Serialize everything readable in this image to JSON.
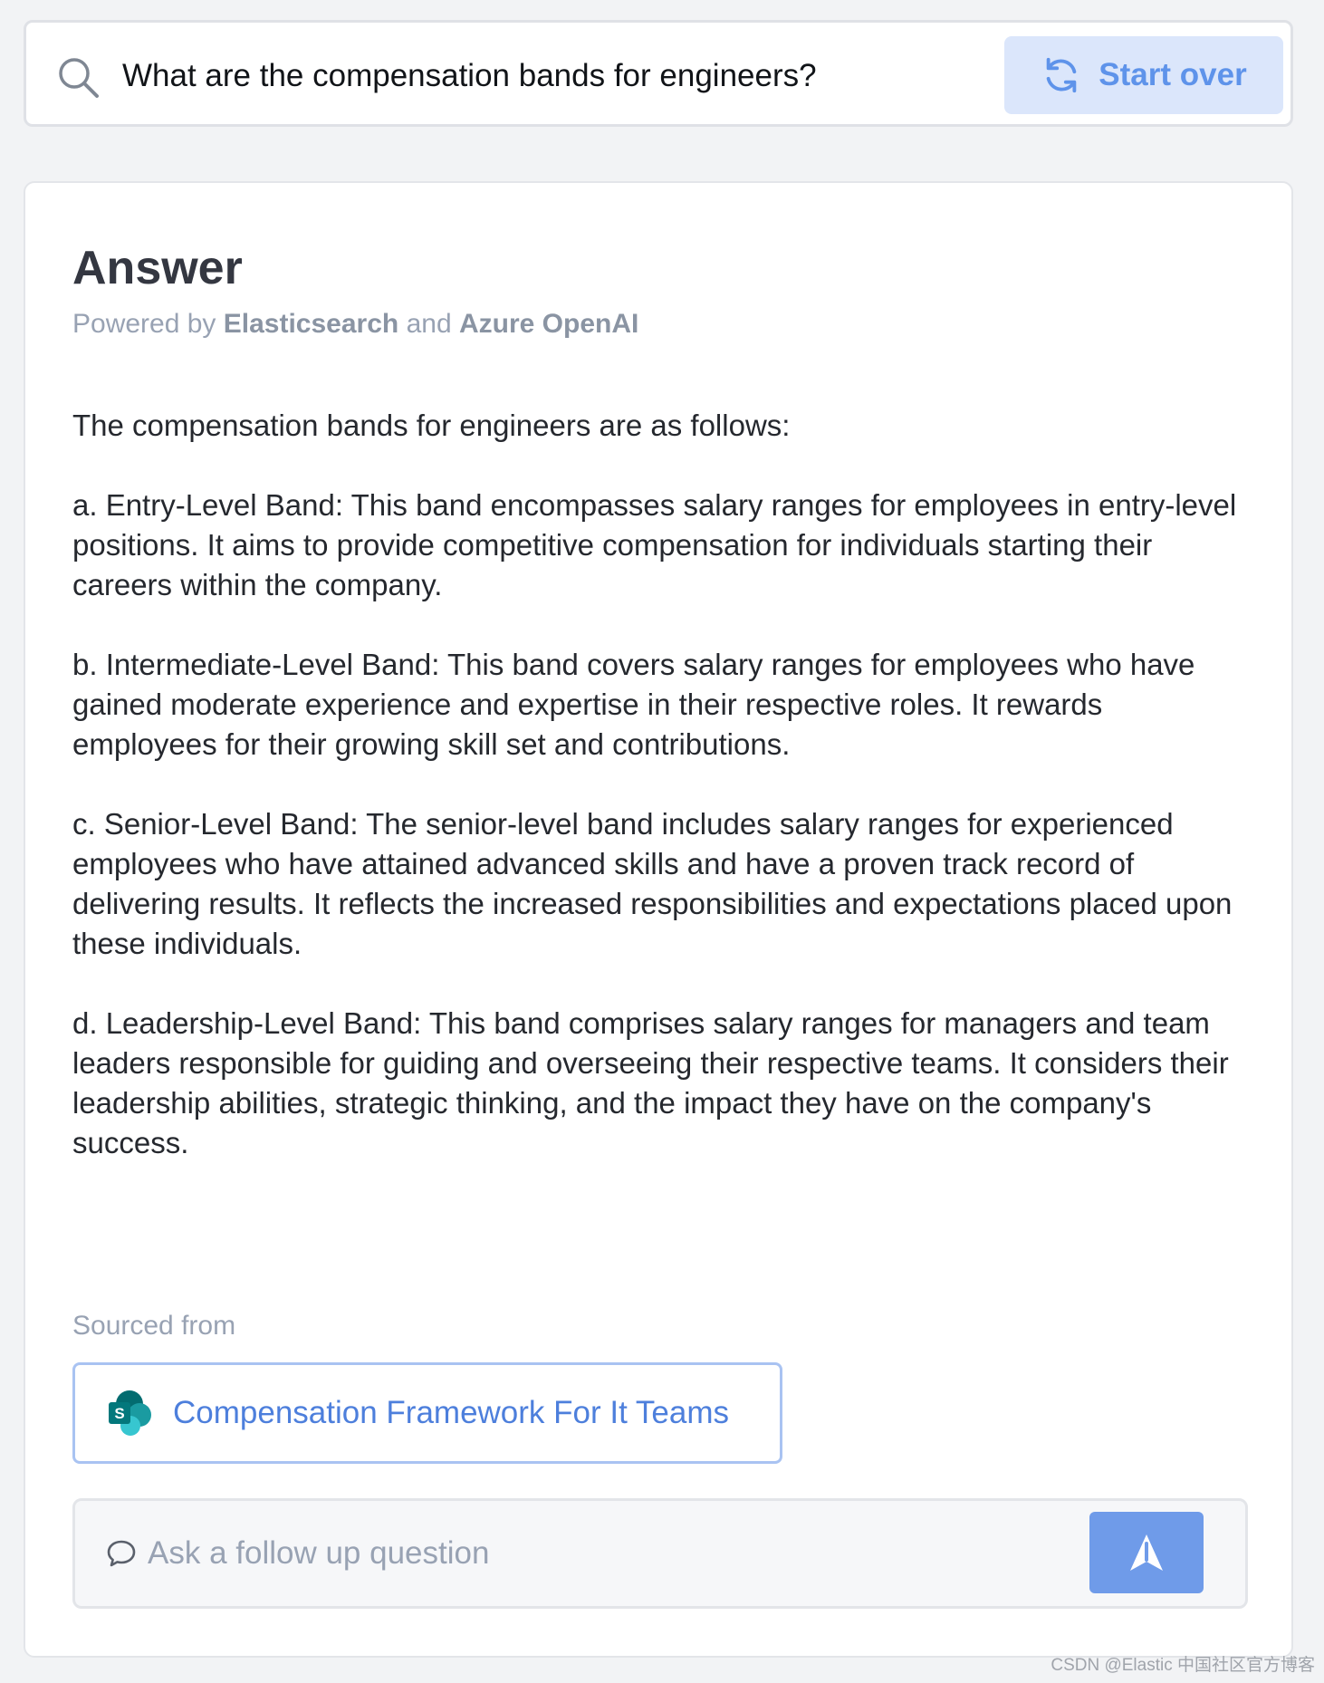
{
  "search": {
    "query": "What are the compensation bands for engineers?",
    "search_icon": "search-icon",
    "start_over_label": "Start over",
    "start_over_icon": "refresh-icon"
  },
  "answer": {
    "title": "Answer",
    "powered_by": {
      "prefix": "Powered by ",
      "engine": "Elasticsearch",
      "connector": " and ",
      "llm": "Azure OpenAI"
    },
    "paragraphs": [
      "The compensation bands for engineers are as follows:",
      "a. Entry-Level Band: This band encompasses salary ranges for employees in entry-level positions. It aims to provide competitive compensation for individuals starting their careers within the company.",
      "b. Intermediate-Level Band: This band covers salary ranges for employees who have gained moderate experience and expertise in their respective roles. It rewards employees for their growing skill set and contributions.",
      "c. Senior-Level Band: The senior-level band includes salary ranges for experienced employees who have attained advanced skills and have a proven track record of delivering results. It reflects the increased responsibilities and expectations placed upon these individuals.",
      "d. Leadership-Level Band: This band comprises salary ranges for managers and team leaders responsible for guiding and overseeing their respective teams. It considers their leadership abilities, strategic thinking, and the impact they have on the company's success."
    ]
  },
  "sources": {
    "label": "Sourced from",
    "items": [
      {
        "title": "Compensation Framework For It Teams",
        "icon": "sharepoint-icon"
      }
    ]
  },
  "followup": {
    "placeholder": "Ask a follow up question",
    "chat_icon": "chat-bubble-icon",
    "send_icon": "send-arrow-icon"
  },
  "watermark": "CSDN @Elastic 中国社区官方博客",
  "colors": {
    "page_bg": "#f2f3f5",
    "accent": "#5e93ea",
    "button_bg": "#dbe6fb",
    "send_button": "#6f9be9",
    "link": "#4d7fdc",
    "muted": "#98a2b3"
  }
}
